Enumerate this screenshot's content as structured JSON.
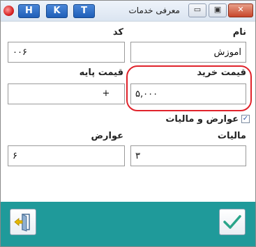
{
  "window": {
    "title": "معرفی خدمات",
    "hotkeys": [
      "H",
      "K",
      "T"
    ],
    "controls": {
      "minimize": "▭",
      "maximize": "▣",
      "close": "✕"
    }
  },
  "form": {
    "name_label": "نام",
    "name_value": "آموزش",
    "code_label": "کد",
    "code_value": "۰۰۶",
    "purchase_price_label": "قیمت خرید",
    "purchase_price_value": "۵,۰۰۰",
    "base_price_label": "قیمت پایه",
    "base_price_value": "+",
    "tax_checkbox_label": "عوارض و مالیات",
    "tax_checkbox_checked": true,
    "tax_label": "مالیات",
    "tax_value": "۳",
    "duty_label": "عوارض",
    "duty_value": "۶"
  },
  "icons": {
    "exit": "exit-door-icon",
    "confirm": "checkmark-icon"
  },
  "colors": {
    "bottom_bar": "#1f9a9a",
    "highlight": "#e0232b",
    "hotkey_button": "#2a6fcf",
    "confirm_check": "#2aa58a",
    "exit_arrow": "#e6b800"
  }
}
